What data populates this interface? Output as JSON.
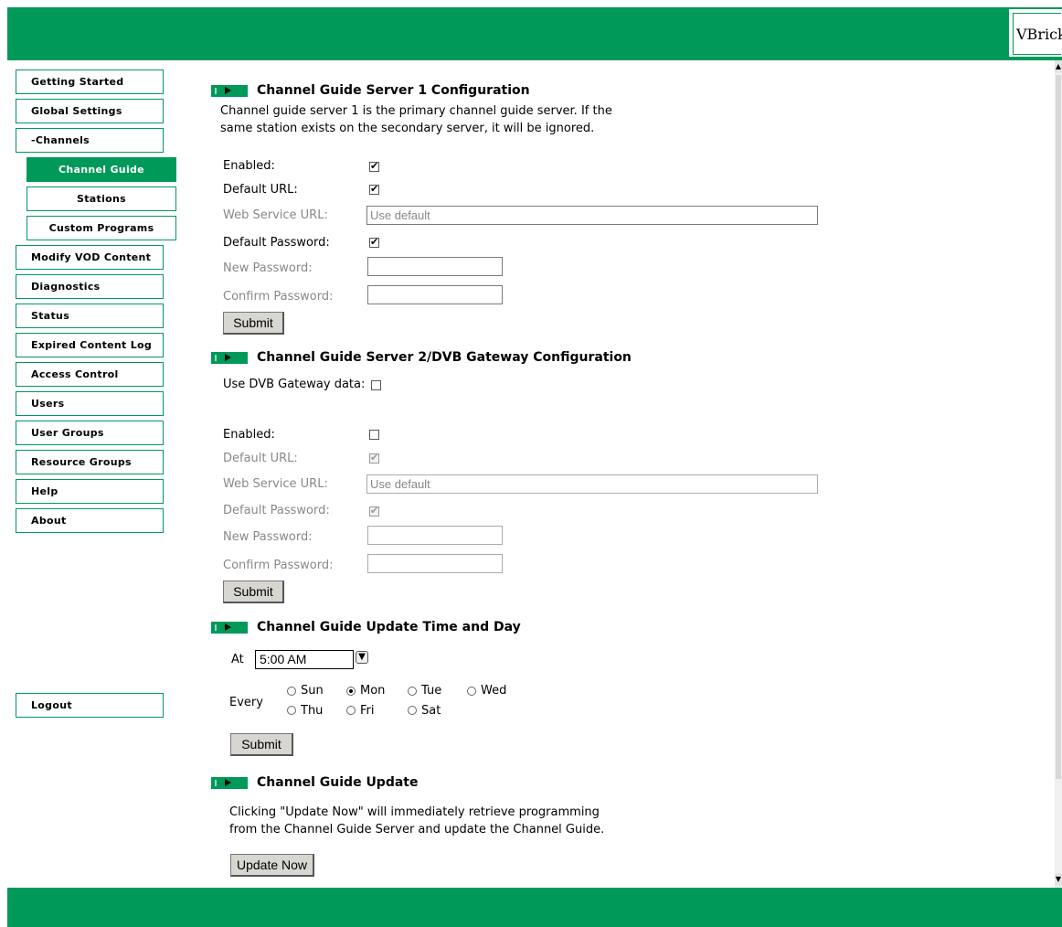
{
  "brand": {
    "logo_text": "VBrick",
    "accent": "#00995a"
  },
  "sidebar": {
    "items": [
      {
        "label": "Getting Started"
      },
      {
        "label": "Global Settings"
      },
      {
        "label": "-Channels"
      },
      {
        "label": "Channel Guide",
        "active": true
      },
      {
        "label": "Stations"
      },
      {
        "label": "Custom Programs"
      },
      {
        "label": "Modify VOD Content"
      },
      {
        "label": "Diagnostics"
      },
      {
        "label": "Status"
      },
      {
        "label": "Expired Content Log"
      },
      {
        "label": "Access Control"
      },
      {
        "label": "Users"
      },
      {
        "label": "User Groups"
      },
      {
        "label": "Resource Groups"
      },
      {
        "label": "Help"
      },
      {
        "label": "About"
      }
    ],
    "logout_label": "Logout"
  },
  "server1": {
    "title": "Channel Guide Server 1 Configuration",
    "desc_line1": "Channel guide server 1 is the primary channel guide server. If the",
    "desc_line2": "same station exists on the secondary server, it will be ignored.",
    "enabled_label": "Enabled:",
    "enabled": true,
    "default_url_label": "Default URL:",
    "default_url": true,
    "ws_url_label": "Web Service URL:",
    "ws_url_placeholder": "Use default",
    "default_password_label": "Default Password:",
    "default_password": true,
    "new_password_label": "New Password:",
    "confirm_password_label": "Confirm Password:",
    "submit_label": "Submit"
  },
  "server2": {
    "title": "Channel Guide Server 2/DVB Gateway Configuration",
    "use_dvb_label": "Use DVB Gateway data:",
    "use_dvb": false,
    "enabled_label": "Enabled:",
    "enabled": false,
    "default_url_label": "Default URL:",
    "default_url": true,
    "ws_url_label": "Web Service URL:",
    "ws_url_placeholder": "Use default",
    "default_password_label": "Default Password:",
    "default_password": true,
    "new_password_label": "New Password:",
    "confirm_password_label": "Confirm Password:",
    "submit_label": "Submit"
  },
  "update_time": {
    "title": "Channel Guide Update Time and Day",
    "at_label": "At",
    "time_value": "5:00 AM",
    "every_label": "Every",
    "days": [
      {
        "label": "Sun",
        "checked": false
      },
      {
        "label": "Mon",
        "checked": true
      },
      {
        "label": "Tue",
        "checked": false
      },
      {
        "label": "Wed",
        "checked": false
      },
      {
        "label": "Thu",
        "checked": false
      },
      {
        "label": "Fri",
        "checked": false
      },
      {
        "label": "Sat",
        "checked": false
      }
    ],
    "submit_label": "Submit"
  },
  "update_now": {
    "title": "Channel Guide Update",
    "desc_line1": "Clicking \"Update Now\" will immediately retrieve programming",
    "desc_line2": "from the Channel Guide Server and update the Channel Guide.",
    "button_label": "Update Now"
  }
}
